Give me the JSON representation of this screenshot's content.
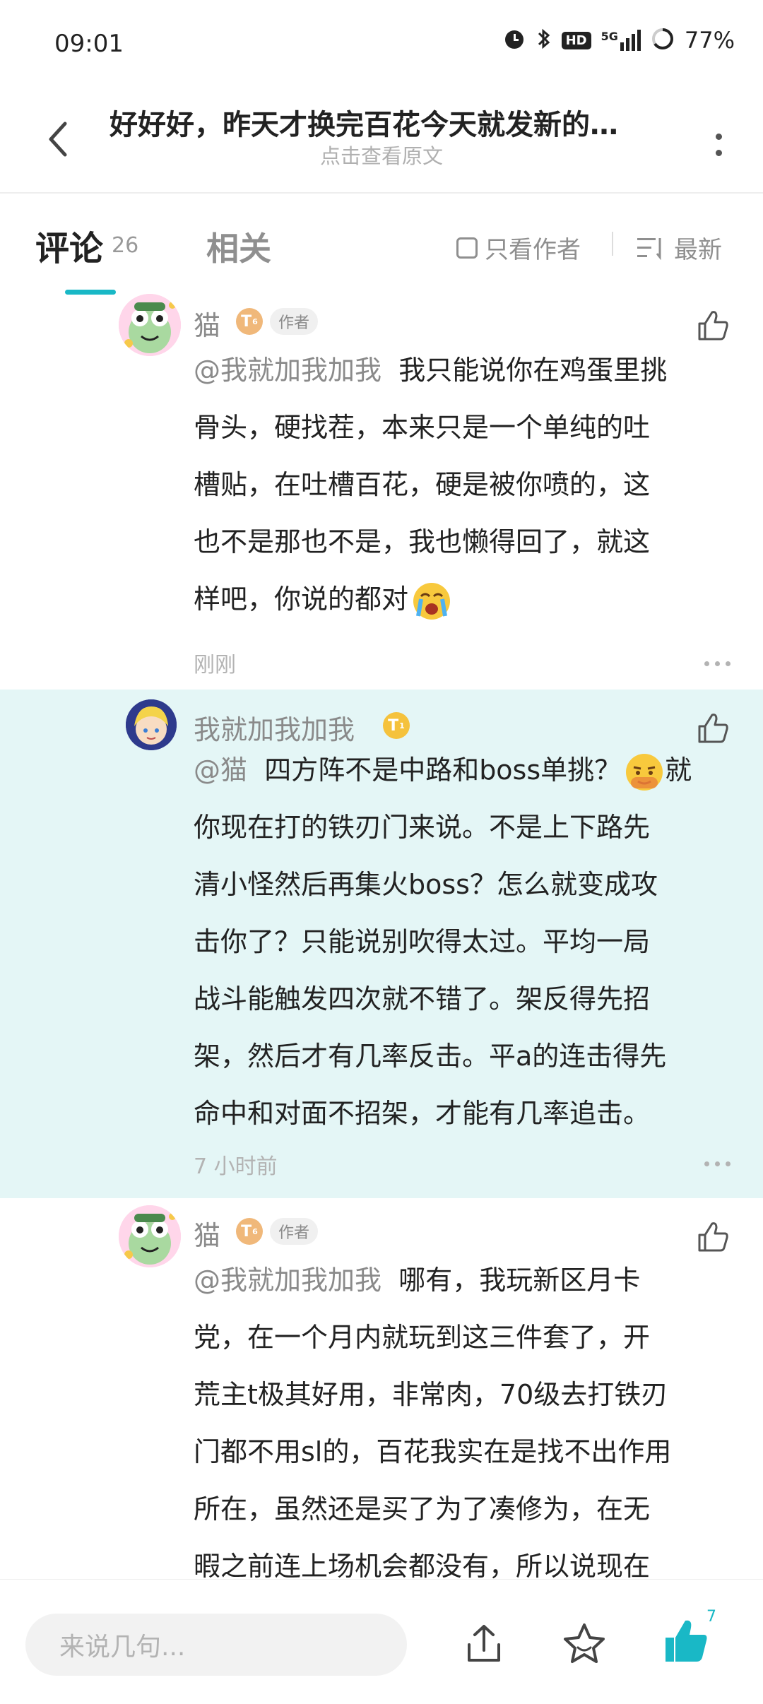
{
  "status_bar": {
    "time": "09:01",
    "network": "5G",
    "hd": "HD",
    "battery": "77%"
  },
  "header": {
    "title": "好好好，昨天才换完百花今天就发新的…",
    "subtitle": "点击查看原文"
  },
  "tabs": {
    "comments_label": "评论",
    "comments_count": "26",
    "related_label": "相关",
    "author_only_label": "只看作者",
    "sort_label": "最新"
  },
  "comments": [
    {
      "username": "猫",
      "level": "T",
      "level_sub": "6",
      "author_tag": "作者",
      "mention": "@我就加我加我",
      "lines": [
        "我只能说你在鸡蛋里挑",
        "骨头，硬找茬，本来只是一个单纯的吐",
        "槽贴，在吐槽百花，硬是被你喷的，这",
        "也不是那也不是，我也懒得回了，就这",
        "样吧，你说的都对"
      ],
      "emoji": "crying-face",
      "time": "刚刚"
    },
    {
      "username": "我就加我加我",
      "level": "T",
      "level_sub": "1",
      "mention": "@猫",
      "lines": [
        "四方阵不是中路和boss单挑？",
        "就",
        "你现在打的铁刃门来说。不是上下路先",
        "清小怪然后再集火boss？怎么就变成攻",
        "击你了？只能说别吹得太过。平均一局",
        "战斗能触发四次就不错了。架反得先招",
        "架，然后才有几率反击。平a的连击得先",
        "命中和对面不招架，才能有几率追击。"
      ],
      "emoji": "flirty-face",
      "time": "7 小时前"
    },
    {
      "username": "猫",
      "level": "T",
      "level_sub": "6",
      "author_tag": "作者",
      "mention": "@我就加我加我",
      "lines": [
        "哪有，我玩新区月卡",
        "党，在一个月内就玩到这三件套了，开",
        "荒主t极其好用，非常肉，70级去打铁刃",
        "门都不用sl的，百花我实在是找不出作用",
        "所在，虽然还是买了为了凑修为，在无",
        "暇之前连上场机会都没有，所以说现在"
      ]
    }
  ],
  "bottom_bar": {
    "input_placeholder": "来说几句...",
    "like_count": "7"
  },
  "colors": {
    "accent": "#19b8c6",
    "highlight_bg": "#e4f6f6",
    "muted_text": "#8a8a8a"
  }
}
